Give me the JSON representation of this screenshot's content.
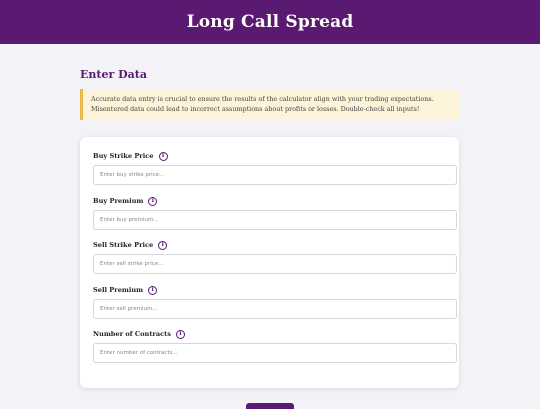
{
  "header": {
    "title": "Long Call Spread"
  },
  "section": {
    "title": "Enter Data"
  },
  "notice": {
    "text": "Accurate data entry is crucial to ensure the results of the calculator align with your trading expectations. Misentered data could lead to incorrect assumptions about profits or losses. Double-check all inputs!"
  },
  "fields": [
    {
      "label": "Buy Strike Price",
      "placeholder": "Enter buy strike price...",
      "value": ""
    },
    {
      "label": "Buy Premium",
      "placeholder": "Enter buy premium...",
      "value": ""
    },
    {
      "label": "Sell Strike Price",
      "placeholder": "Enter sell strike price...",
      "value": ""
    },
    {
      "label": "Sell Premium",
      "placeholder": "Enter sell premium...",
      "value": ""
    },
    {
      "label": "Number of Contracts",
      "placeholder": "Enter number of contracts...",
      "value": ""
    }
  ],
  "icons": {
    "info": "info-icon"
  },
  "colors": {
    "brand": "#5b1a72",
    "notice_bg": "#fdf3d8",
    "notice_border": "#e9b94a"
  }
}
